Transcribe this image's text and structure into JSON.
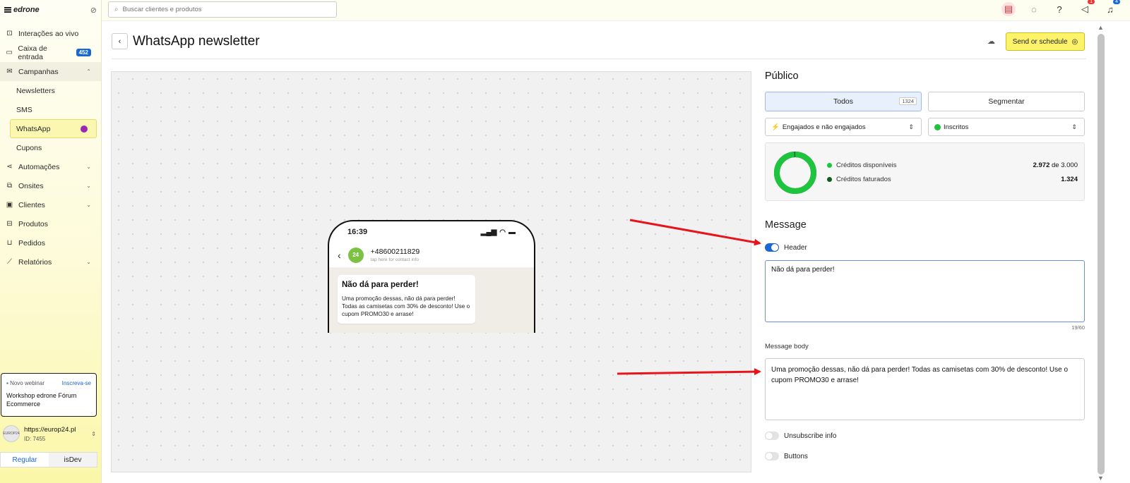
{
  "sidebar": {
    "brand": "edrone",
    "items": [
      {
        "label": "Interações ao vivo",
        "icon": "live-icon"
      },
      {
        "label": "Caixa de entrada",
        "icon": "inbox-icon",
        "badge": "452"
      },
      {
        "label": "Campanhas",
        "icon": "mail-icon"
      },
      {
        "label": "Newsletters"
      },
      {
        "label": "SMS"
      },
      {
        "label": "WhatsApp"
      },
      {
        "label": "Cupons"
      },
      {
        "label": "Automações",
        "icon": "automation-icon"
      },
      {
        "label": "Onsites",
        "icon": "onsite-icon"
      },
      {
        "label": "Clientes",
        "icon": "clients-icon"
      },
      {
        "label": "Produtos",
        "icon": "products-icon"
      },
      {
        "label": "Pedidos",
        "icon": "cart-icon"
      },
      {
        "label": "Relatórios",
        "icon": "reports-icon"
      }
    ],
    "webinar": {
      "tag": "Novo webinar",
      "link": "Inscreva-se",
      "title": "Workshop edrone Fórum Ecommerce"
    },
    "account": {
      "url": "https://europ24.pl",
      "id": "ID: 7455",
      "avatar": "EUROP24"
    },
    "modes": [
      "Regular",
      "isDev"
    ]
  },
  "topbar": {
    "search_placeholder": "Buscar clientes e produtos",
    "announce_count": "1",
    "notif_count": "4"
  },
  "header": {
    "title": "WhatsApp newsletter",
    "send_label": "Send or schedule"
  },
  "phone": {
    "time": "16:39",
    "contact": "+48600211829",
    "contact_sub": "tap here for contact info",
    "avatar": "24",
    "msg_title": "Não dá para perder!",
    "msg_body": "Uma promoção dessas, não dá para perder! Todas as camisetas com 30% de desconto! Use o cupom PROMO30 e arrase!"
  },
  "audience": {
    "title": "Público",
    "tabs": [
      {
        "label": "Todos",
        "count": "1324"
      },
      {
        "label": "Segmentar"
      }
    ],
    "select_engagement": "Engajados e não engajados",
    "select_status": "Inscritos",
    "credits": {
      "available_label": "Créditos disponíveis",
      "available_value": "2.972",
      "available_of": "de 3.000",
      "billed_label": "Créditos faturados",
      "billed_value": "1.324",
      "available_fraction": 0.9907,
      "color_available": "#1ec33e",
      "color_billed": "#0f5a1f"
    }
  },
  "message": {
    "title": "Message",
    "header_toggle_label": "Header",
    "header_toggle_on": true,
    "header_text": "Não dá para perder!",
    "header_counter": "19/60",
    "body_label": "Message body",
    "body_text": "Uma promoção dessas, não dá para perder! Todas as camisetas com 30% de desconto! Use o cupom PROMO30 e arrase!",
    "unsubscribe_label": "Unsubscribe info",
    "buttons_label": "Buttons"
  },
  "colors": {
    "accent": "#1967d2",
    "send": "#fdf36b",
    "arrow": "#e8141b"
  }
}
